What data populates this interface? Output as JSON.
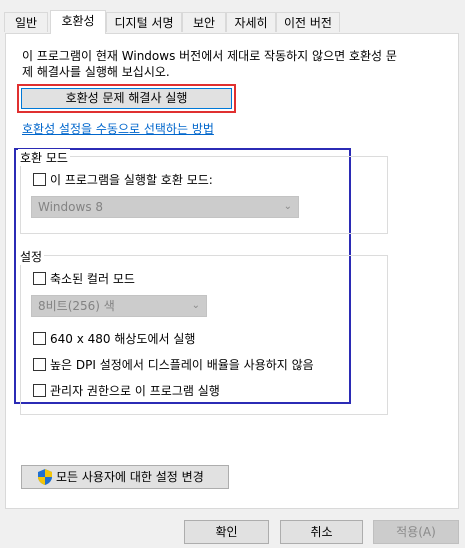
{
  "tabs": [
    {
      "label": "일반"
    },
    {
      "label": "호환성"
    },
    {
      "label": "디지털 서명"
    },
    {
      "label": "보안"
    },
    {
      "label": "자세히"
    },
    {
      "label": "이전 버전"
    }
  ],
  "description": "이 프로그램이 현재 Windows 버전에서 제대로 작동하지 않으면 호환성 문제 해결사를 실행해 보십시오.",
  "troubleshooter_button": "호환성 문제 해결사 실행",
  "manual_link": "호환성 설정을 수동으로 선택하는 방법",
  "compat_mode": {
    "group_label": "호환 모드",
    "checkbox_label": "이 프로그램을 실행할 호환 모드:",
    "select_value": "Windows 8"
  },
  "settings": {
    "group_label": "설정",
    "reduced_color_label": "축소된 컬러 모드",
    "color_select_value": "8비트(256) 색",
    "res_640_label": "640 x 480 해상도에서 실행",
    "dpi_label": "높은 DPI 설정에서 디스플레이 배율을 사용하지 않음",
    "admin_label": "관리자 권한으로 이 프로그램 실행"
  },
  "all_users_button": "모든 사용자에 대한 설정 변경",
  "footer": {
    "ok": "확인",
    "cancel": "취소",
    "apply": "적용(A)"
  },
  "colors": {
    "highlight_red": "#e03030",
    "highlight_blue": "#2b2bb5",
    "link": "#0066cc"
  }
}
